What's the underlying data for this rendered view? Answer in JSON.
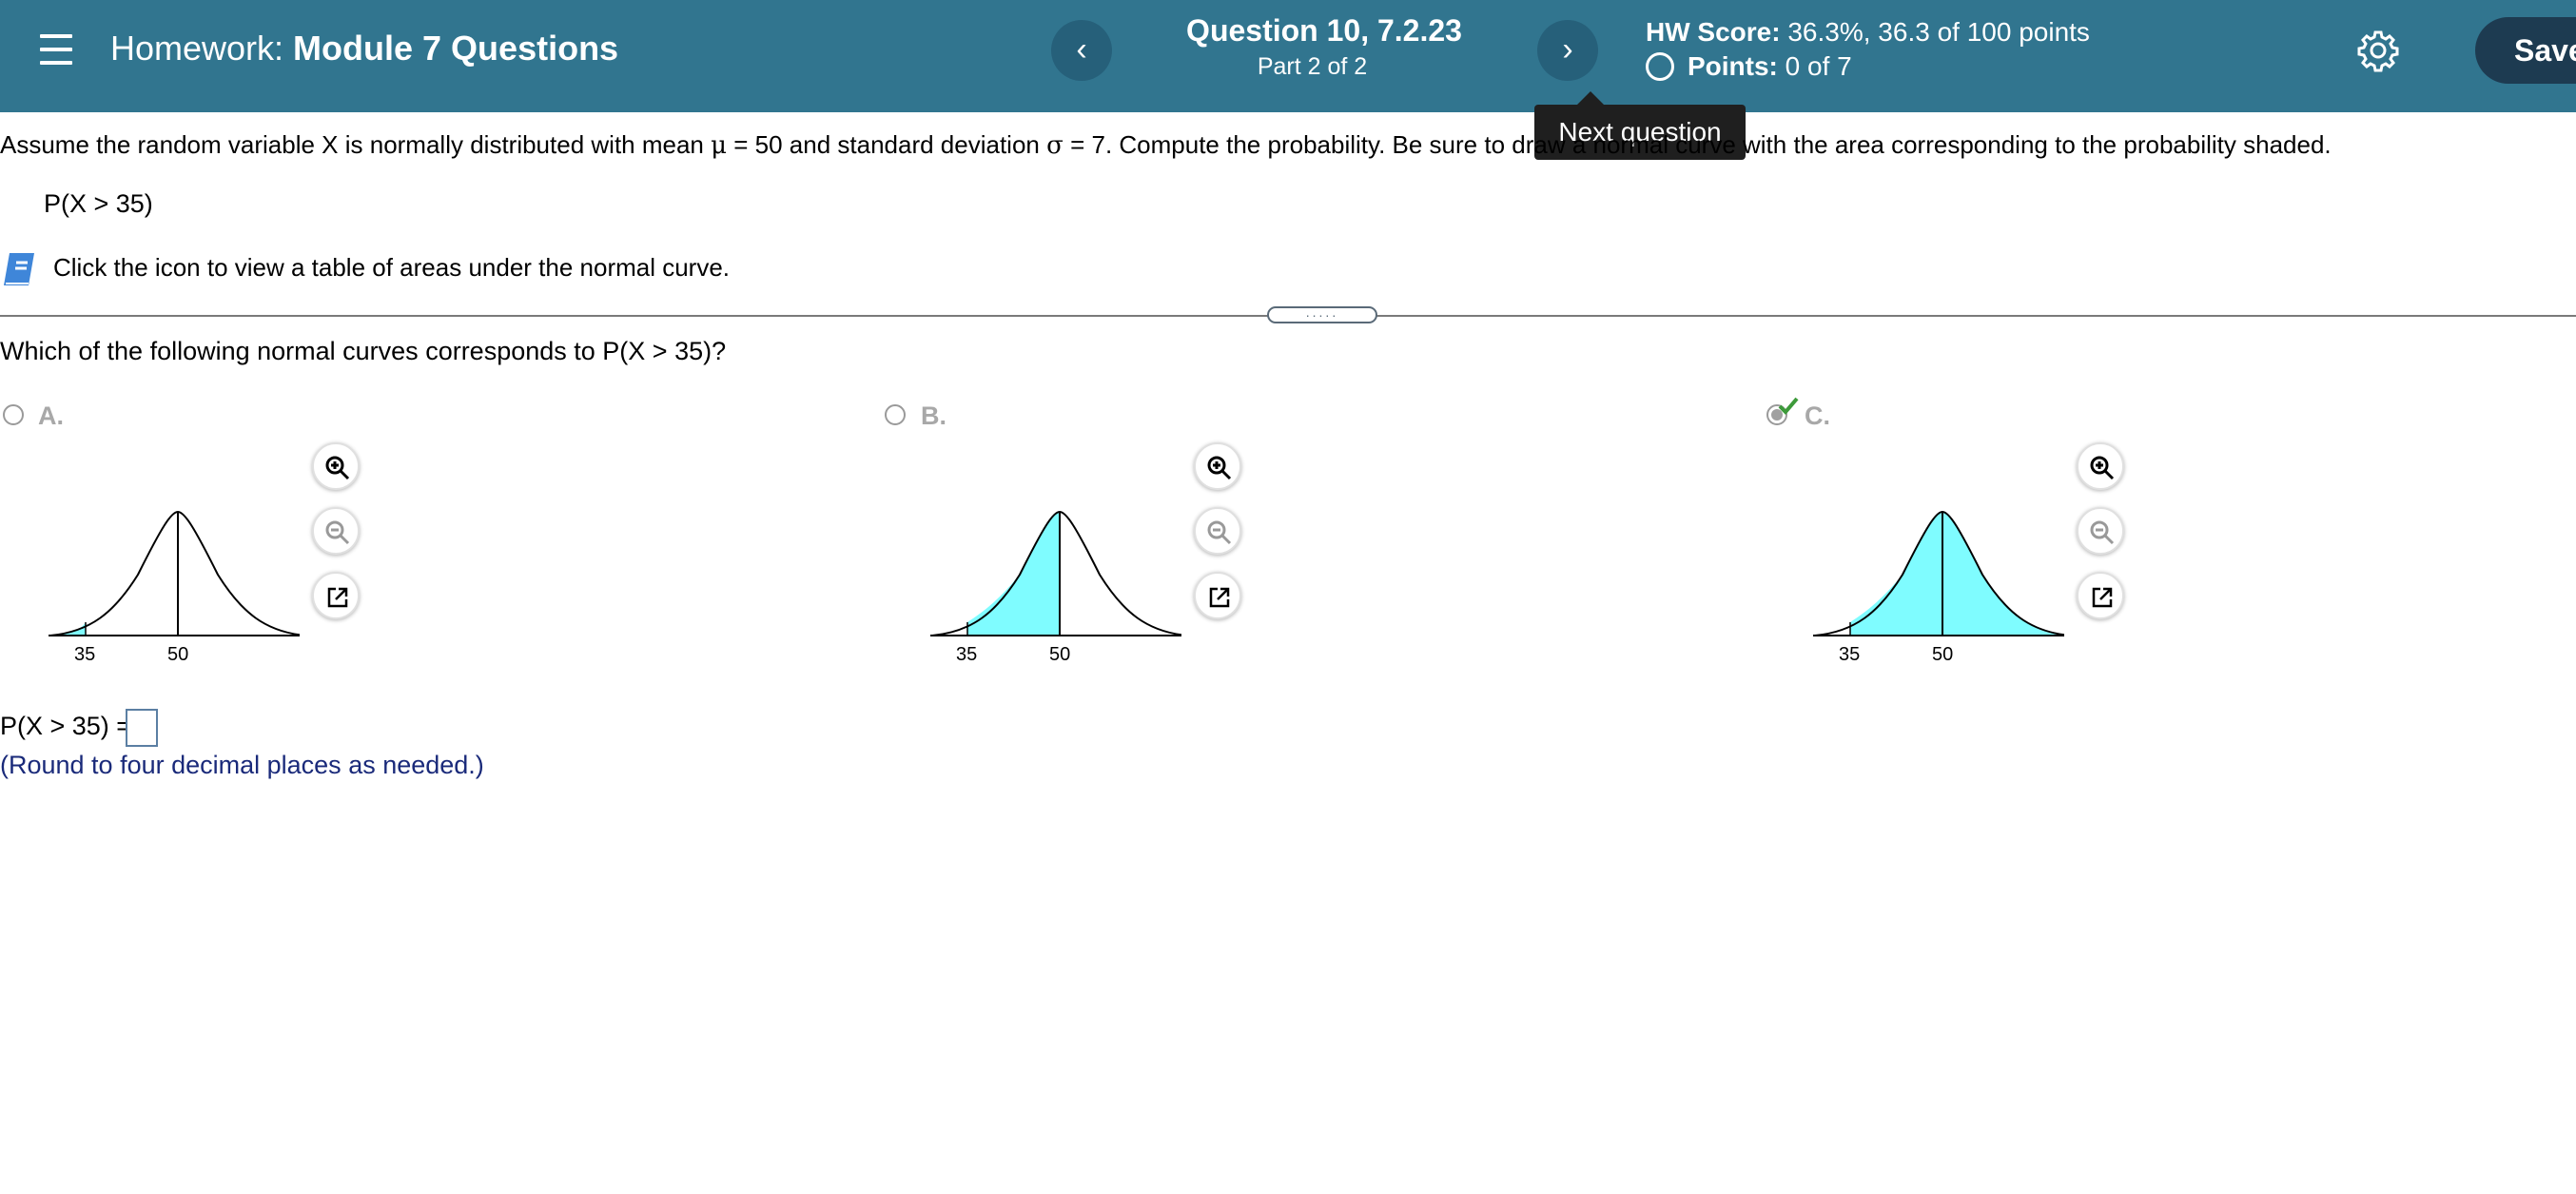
{
  "header": {
    "menu_icon": "hamburger-menu-icon",
    "hw_prefix": "Homework:",
    "hw_name": "Module 7 Questions",
    "prev_icon": "‹",
    "next_icon": "›",
    "question_title": "Question 10, 7.2.23",
    "question_part": "Part 2 of 2",
    "hw_score_label": "HW Score:",
    "hw_score_value": "36.3%, 36.3 of 100 points",
    "points_label": "Points:",
    "points_value": "0 of 7",
    "settings_icon": "gear-icon",
    "save_label": "Save",
    "tooltip": "Next question",
    "colors": {
      "bar": "#31758f",
      "nav_button": "#26607a",
      "save_button": "#1d3b51"
    }
  },
  "problem": {
    "prompt_before": "Assume the random variable X is normally distributed with mean ",
    "mu": "μ",
    "mean_eq": " = 50 and standard deviation ",
    "sigma": "σ",
    "sd_eq": " = 7. Compute the probability. Be sure to draw a normal curve with the area corresponding to the probability shaded.",
    "probability": "P(X > 35)",
    "book_icon": "book-icon",
    "book_text": "Click the icon to view a table of areas under the normal curve."
  },
  "divider_handle": ".....",
  "question": {
    "text": "Which of the following normal curves corresponds to P(X > 35)?",
    "choices": [
      {
        "label": "A.",
        "selected": false,
        "shading": "left-tail",
        "ticks": [
          "35",
          "50"
        ]
      },
      {
        "label": "B.",
        "selected": false,
        "shading": "between",
        "ticks": [
          "35",
          "50"
        ]
      },
      {
        "label": "C.",
        "selected": true,
        "correct": true,
        "shading": "right-of-35",
        "ticks": [
          "35",
          "50"
        ]
      }
    ],
    "tool_icons": [
      "zoom-in-icon",
      "zoom-out-icon",
      "popout-icon"
    ],
    "shade_color": "#7ffcff"
  },
  "answer": {
    "label": "P(X > 35) =",
    "value": "",
    "note": "(Round to four decimal places as needed.)"
  }
}
